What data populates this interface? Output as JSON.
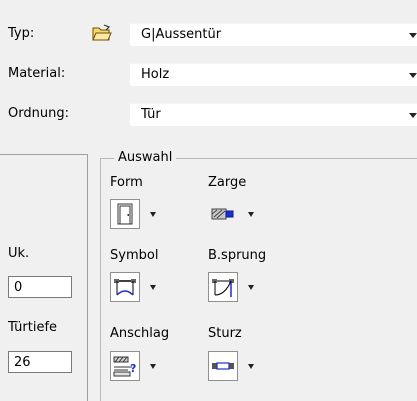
{
  "top": {
    "typ_label": "Typ:",
    "typ_value": "G|Aussentür",
    "material_label": "Material:",
    "material_value": "Holz",
    "ordnung_label": "Ordnung:",
    "ordnung_value": "Tür"
  },
  "left": {
    "uk_label": "Uk.",
    "uk_value": "0",
    "tuertiefe_label": "Türtiefe",
    "tuertiefe_value": "26"
  },
  "auswahl": {
    "title": "Auswahl",
    "form": "Form",
    "zarge": "Zarge",
    "symbol": "Symbol",
    "bsprung": "B.sprung",
    "anschlag": "Anschlag",
    "sturz": "Sturz"
  },
  "icons": {
    "open_folder": "folder-open-icon",
    "form": "door-form-icon",
    "zarge": "frame-icon",
    "symbol": "door-swing-symbol-icon",
    "bsprung": "door-jump-icon",
    "anschlag": "stop-unknown-icon",
    "sturz": "lintel-icon"
  }
}
